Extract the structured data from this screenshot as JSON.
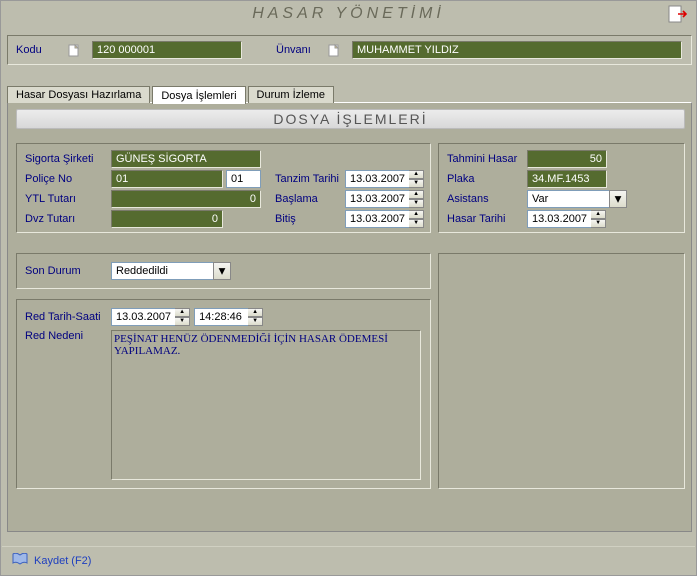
{
  "window": {
    "title": "HASAR YÖNETİMİ"
  },
  "header": {
    "kodu_label": "Kodu",
    "kodu_value": "120 000001",
    "unvani_label": "Ünvanı",
    "unvani_value": "MUHAMMET YILDIZ"
  },
  "tabs": [
    {
      "label": "Hasar Dosyası Hazırlama",
      "active": false
    },
    {
      "label": "Dosya İşlemleri",
      "active": true
    },
    {
      "label": "Durum İzleme",
      "active": false
    }
  ],
  "section_title": "DOSYA İŞLEMLERİ",
  "g1": {
    "sigorta_label": "Sigorta Şirketi",
    "sigorta_value": "GÜNEŞ SİGORTA",
    "police_label": "Poliçe No",
    "police_a": "01",
    "police_b": "01",
    "tanzim_label": "Tanzim Tarihi",
    "tanzim_value": "13.03.2007",
    "ytl_label": "YTL   Tutarı",
    "ytl_value": "0",
    "baslama_label": "Başlama",
    "baslama_value": "13.03.2007",
    "dvz_label": "Dvz Tutarı",
    "dvz_value": "0",
    "bitis_label": "Bitiş",
    "bitis_value": "13.03.2007"
  },
  "g2": {
    "tahmini_label": "Tahmini Hasar",
    "tahmini_value": "50",
    "plaka_label": "Plaka",
    "plaka_value": "34.MF.1453",
    "asistans_label": "Asistans",
    "asistans_value": "Var",
    "hasar_tarihi_label": "Hasar Tarihi",
    "hasar_tarihi_value": "13.03.2007"
  },
  "son_durum": {
    "label": "Son Durum",
    "value": "Reddedildi"
  },
  "red": {
    "tarih_label": "Red Tarih-Saati",
    "tarih_value": "13.03.2007",
    "saat_value": "14:28:46",
    "neden_label": "Red Nedeni",
    "neden_value": "PEŞİNAT HENÜZ ÖDENMEDİĞİ İÇİN HASAR ÖDEMESİ YAPILAMAZ."
  },
  "footer": {
    "save": "Kaydet (F2)"
  }
}
